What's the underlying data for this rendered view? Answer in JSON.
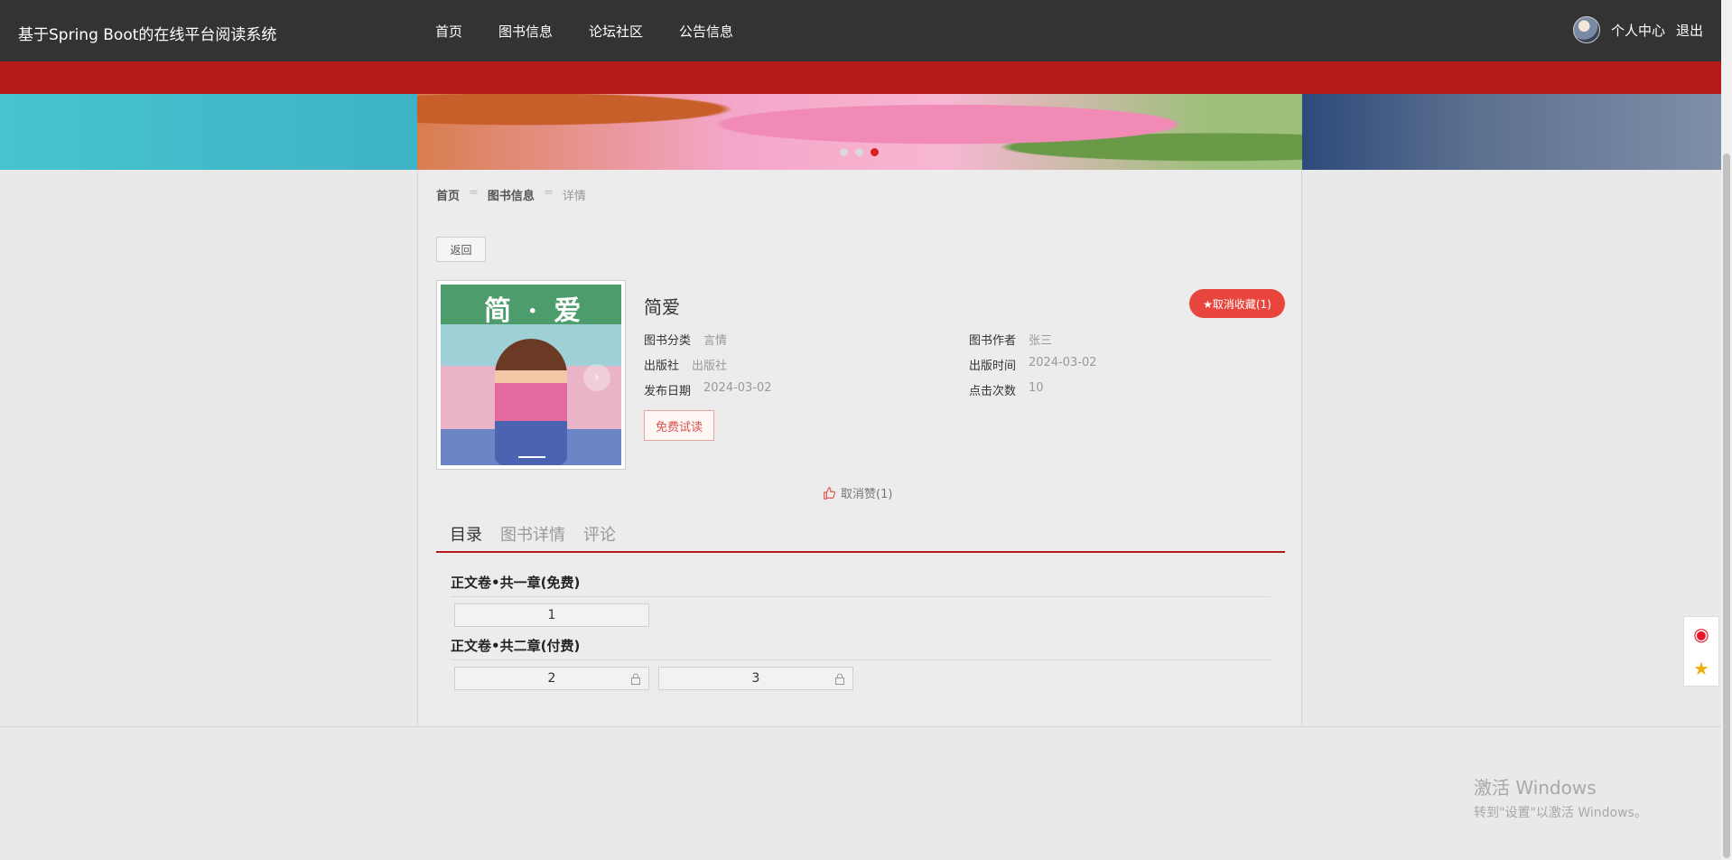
{
  "header": {
    "brand": "基于Spring Boot的在线平台阅读系统",
    "nav": [
      "首页",
      "图书信息",
      "论坛社区",
      "公告信息"
    ],
    "user_center": "个人中心",
    "logout": "退出"
  },
  "breadcrumb": {
    "home": "首页",
    "section": "图书信息",
    "current": "详情",
    "separator": "="
  },
  "back_label": "返回",
  "book": {
    "cover_title": "简 · 爱",
    "title": "简爱",
    "fav_label": "★取消收藏(1)",
    "category_label": "图书分类",
    "category": "言情",
    "author_label": "图书作者",
    "author": "张三",
    "publisher_label": "出版社",
    "publisher": "出版社",
    "pubdate_label": "出版时间",
    "pubdate": "2024-03-02",
    "release_label": "发布日期",
    "release": "2024-03-02",
    "clicks_label": "点击次数",
    "clicks": "10",
    "trial_label": "免费试读",
    "like_label": "取消赞(1)"
  },
  "tabs": [
    "目录",
    "图书详情",
    "评论"
  ],
  "volumes": [
    {
      "title": "正文卷•共一章(免费)",
      "chapters": [
        "1"
      ]
    },
    {
      "title": "正文卷•共二章(付费)",
      "chapters": [
        "2",
        "3"
      ]
    }
  ],
  "windows": {
    "line1": "激活 Windows",
    "line2": "转到\"设置\"以激活 Windows。"
  },
  "colors": {
    "topbar": "#333333",
    "accent_red": "#b51a1a",
    "fav_button": "#e8453c"
  }
}
